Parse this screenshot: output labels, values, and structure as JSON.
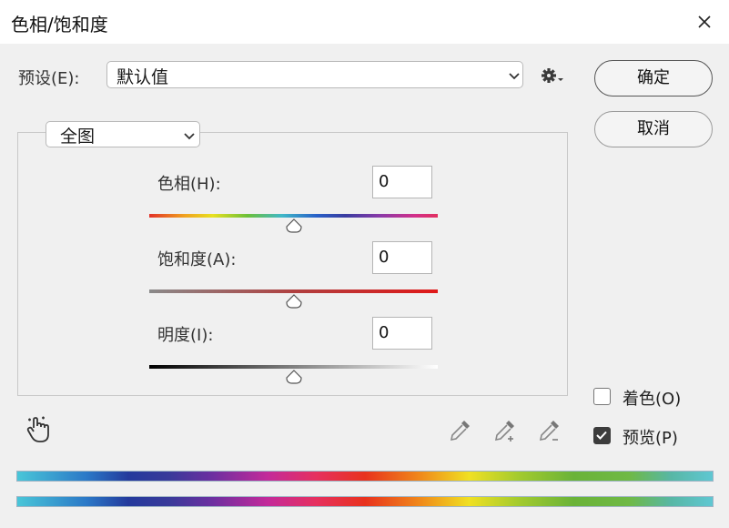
{
  "window": {
    "title": "色相/饱和度"
  },
  "preset": {
    "label": "预设(E):",
    "value": "默认值"
  },
  "buttons": {
    "ok": "确定",
    "cancel": "取消"
  },
  "channel": {
    "value": "全图"
  },
  "hue": {
    "label": "色相(H):",
    "value": "0",
    "slider_fraction": 0.5
  },
  "saturation": {
    "label": "饱和度(A):",
    "value": "0",
    "slider_fraction": 0.5
  },
  "lightness": {
    "label": "明度(I):",
    "value": "0",
    "slider_fraction": 0.5
  },
  "options": {
    "colorize": {
      "label": "着色(O)",
      "checked": false
    },
    "preview": {
      "label": "预览(P)",
      "checked": true
    }
  },
  "icons": {
    "close": "close-icon",
    "gear": "gear-menu-icon",
    "hand": "targeted-adjustment-hand-icon",
    "eyedropper": "eyedropper-icon",
    "eyedropper_add": "eyedropper-plus-icon",
    "eyedropper_subtract": "eyedropper-minus-icon"
  }
}
